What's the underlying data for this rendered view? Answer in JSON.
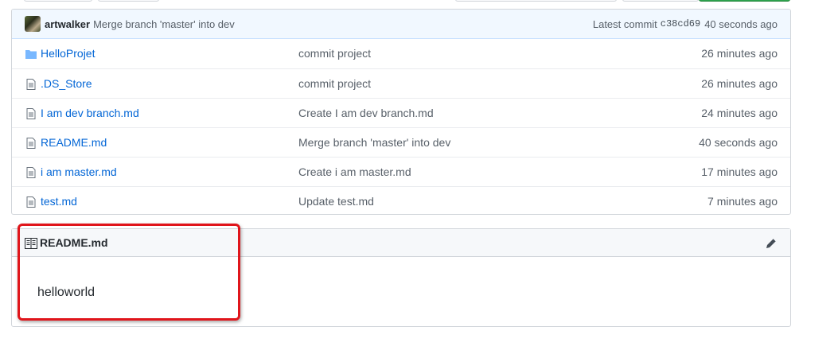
{
  "commit_bar": {
    "author": "artwalker",
    "message": "Merge branch 'master' into dev",
    "latest_label": "Latest commit",
    "sha": "c38cd69",
    "age": "40 seconds ago"
  },
  "files": [
    {
      "name": "HelloProjet",
      "type": "folder",
      "icon": "folder-icon",
      "message": "commit project",
      "age": "26 minutes ago"
    },
    {
      "name": ".DS_Store",
      "type": "file",
      "icon": "file-icon",
      "message": "commit project",
      "age": "26 minutes ago"
    },
    {
      "name": "I am dev branch.md",
      "type": "file",
      "icon": "file-icon",
      "message": "Create I am dev branch.md",
      "age": "24 minutes ago"
    },
    {
      "name": "README.md",
      "type": "file",
      "icon": "file-icon",
      "message": "Merge branch 'master' into dev",
      "age": "40 seconds ago"
    },
    {
      "name": "i am master.md",
      "type": "file",
      "icon": "file-icon",
      "message": "Create i am master.md",
      "age": "17 minutes ago"
    },
    {
      "name": "test.md",
      "type": "file",
      "icon": "file-icon",
      "message": "Update test.md",
      "age": "7 minutes ago"
    }
  ],
  "readme": {
    "title": "README.md",
    "content": "helloworld",
    "icon": "book-icon",
    "edit_icon": "pencil-icon"
  },
  "colors": {
    "link": "#0366d6",
    "commit_bar_bg": "#f1f8ff",
    "highlight": "#e0151b",
    "primary_button": "#2ea44f"
  }
}
